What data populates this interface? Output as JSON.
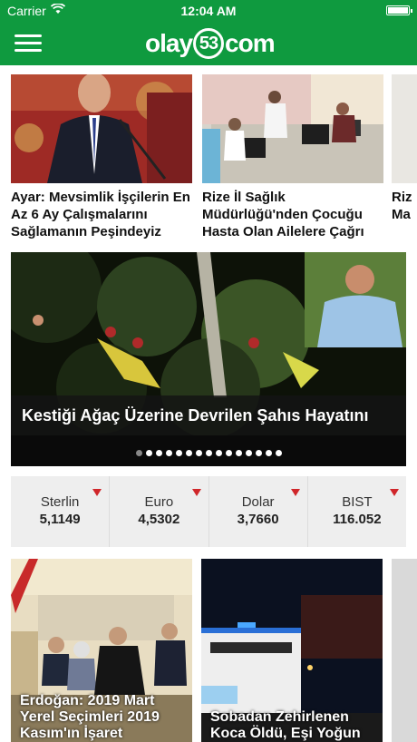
{
  "status": {
    "carrier": "Carrier",
    "time": "12:04 AM"
  },
  "header": {
    "logo_prefix": "olay",
    "logo_number": "53",
    "logo_suffix": "com"
  },
  "top_news": [
    {
      "title": "Ayar: Mevsimlik İşçilerin En Az 6 Ay Çalışmalarını Sağlamanın Peşindeyiz"
    },
    {
      "title": "Rize İl Sağlık Müdürlüğü'nden Çocuğu Hasta Olan Ailelere Çağrı"
    },
    {
      "title": "Riz Ma"
    }
  ],
  "slider": {
    "caption": "Kestiği Ağaç Üzerine Devrilen Şahıs Hayatını",
    "dots": 15,
    "active_dot": 0
  },
  "market": [
    {
      "name": "Sterlin",
      "value": "5,1149",
      "trend": "down"
    },
    {
      "name": "Euro",
      "value": "4,5302",
      "trend": "down"
    },
    {
      "name": "Dolar",
      "value": "3,7660",
      "trend": "down"
    },
    {
      "name": "BIST",
      "value": "116.052",
      "trend": "down"
    }
  ],
  "bottom_news": [
    {
      "title": "Erdoğan: 2019 Mart Yerel Seçimleri 2019 Kasım'ın İşaret"
    },
    {
      "title": "Sobadan Zehirlenen Koca Öldü, Eşi Yoğun"
    }
  ],
  "colors": {
    "brand": "#0f9a3f",
    "down": "#d0262a"
  }
}
